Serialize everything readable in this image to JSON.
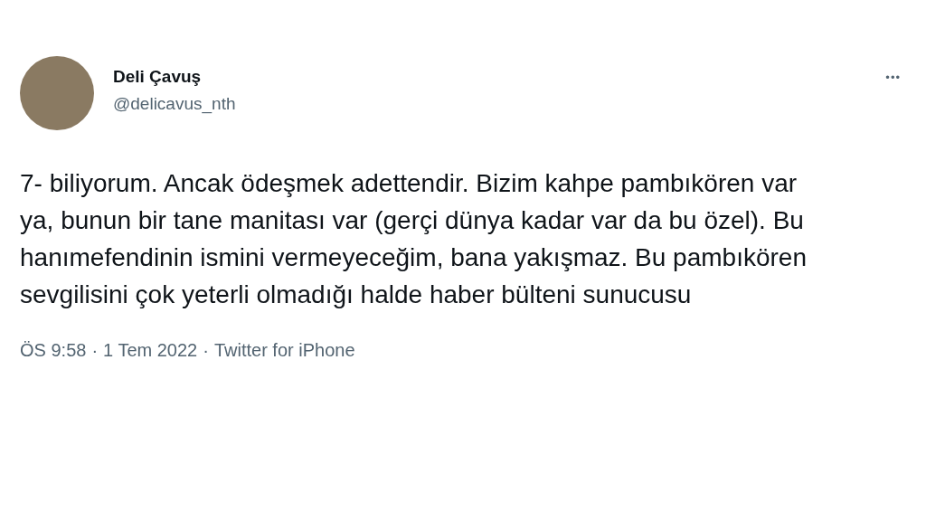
{
  "author": {
    "name": "Deli Çavuş",
    "handle": "@delicavus_nth"
  },
  "more_menu": "•••",
  "tweet_text": "7- biliyorum. Ancak ödeşmek adettendir. Bizim kahpe pambıkören var ya, bunun bir tane manitası var (gerçi dünya kadar var da bu özel). Bu hanımefendinin ismini vermeyeceğim, bana yakışmaz. Bu pambıkören sevgilisini çok yeterli olmadığı halde haber bülteni sunucusu",
  "meta": {
    "time": "ÖS 9:58",
    "separator_1": "·",
    "date": "1 Tem 2022",
    "separator_2": "·",
    "source": "Twitter for iPhone"
  }
}
